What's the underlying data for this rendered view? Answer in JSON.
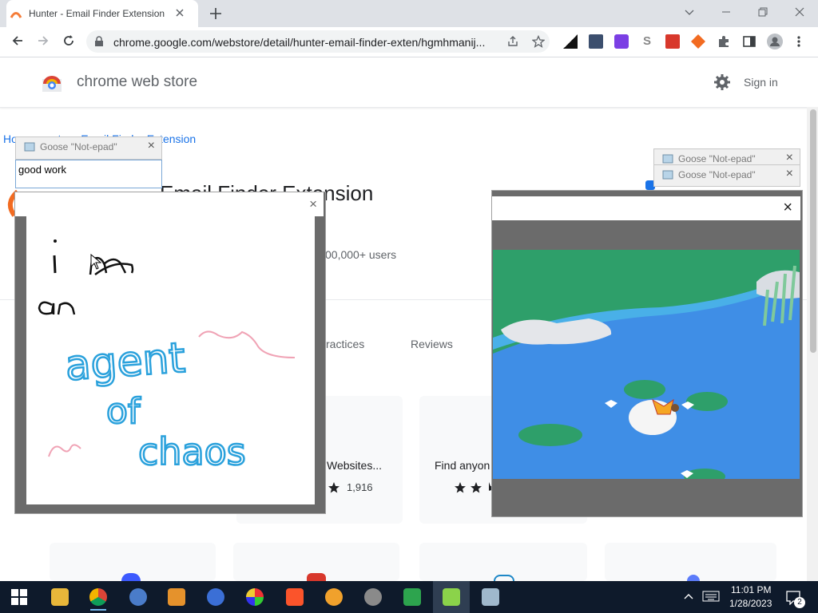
{
  "browser": {
    "tab_title": "Hunter - Email Finder Extension",
    "new_tab_icon": "plus-icon",
    "url": "chrome.google.com/webstore/detail/hunter-email-finder-exten/hgmhmanij..."
  },
  "store": {
    "title": "chrome web store",
    "signin": "Sign in"
  },
  "page": {
    "breadcrumb": "Ho         unter - Email Finder Extension",
    "ext_title": "Email Finder Extension",
    "users": "00,000+ users",
    "tabs": [
      "ractices",
      "Reviews"
    ],
    "cards": [
      {
        "title": "Websites...",
        "rating_count": "1,916"
      },
      {
        "title": "Find anyon"
      }
    ]
  },
  "goose": {
    "notepad_title": "Goose \"Not-epad\"",
    "note_text": "good work",
    "drawing_lines": [
      "i  m",
      "an",
      "agent",
      "of",
      "chaos"
    ]
  },
  "taskbar": {
    "time": "11:01 PM",
    "date": "1/28/2023",
    "notifications": "2"
  },
  "colors": {
    "chrome_tabstrip": "#dee1e6",
    "taskbar": "#0e1a2b",
    "drawing_blue": "#2aa1dc",
    "drawing_pink": "#f0a3b5",
    "pond_water": "#3f8ee6",
    "pond_grass": "#2e9f6a"
  }
}
